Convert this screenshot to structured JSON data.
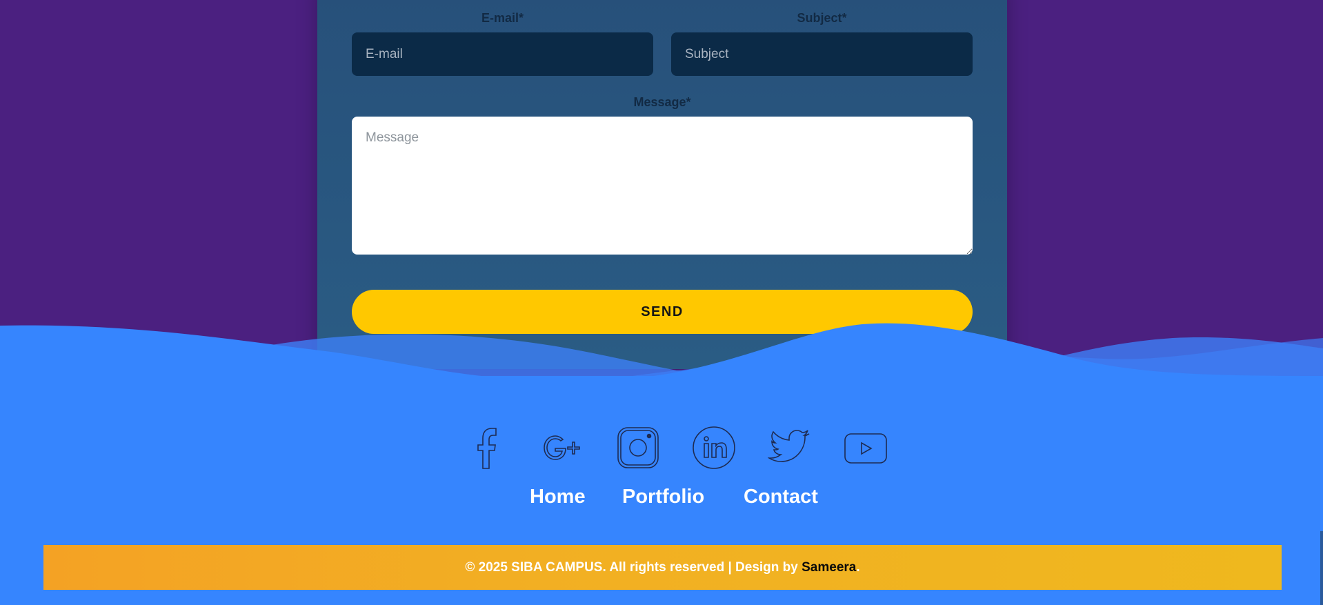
{
  "form": {
    "email_label": "E-mail*",
    "email_placeholder": "E-mail",
    "email_value": "",
    "subject_label": "Subject*",
    "subject_placeholder": "Subject",
    "subject_value": "",
    "message_label": "Message*",
    "message_placeholder": "Message",
    "message_value": "",
    "send_label": "SEND"
  },
  "social": [
    {
      "icon": "facebook-icon"
    },
    {
      "icon": "google-plus-icon"
    },
    {
      "icon": "instagram-icon"
    },
    {
      "icon": "linkedin-icon"
    },
    {
      "icon": "twitter-icon"
    },
    {
      "icon": "youtube-icon"
    }
  ],
  "nav": {
    "home": "Home",
    "portfolio": "Portfolio",
    "contact": "Contact"
  },
  "footer": {
    "copyright": "© 2025 SIBA CAMPUS. All rights reserved | Design by ",
    "author": "Sameera",
    "end": "."
  },
  "colors": {
    "background": "#4b2080",
    "card": "#27507a",
    "input_dark": "#0b2a47",
    "send_button": "#ffc800",
    "footer_blue": "#3685fe",
    "copyright_bar": "#f4a224"
  }
}
